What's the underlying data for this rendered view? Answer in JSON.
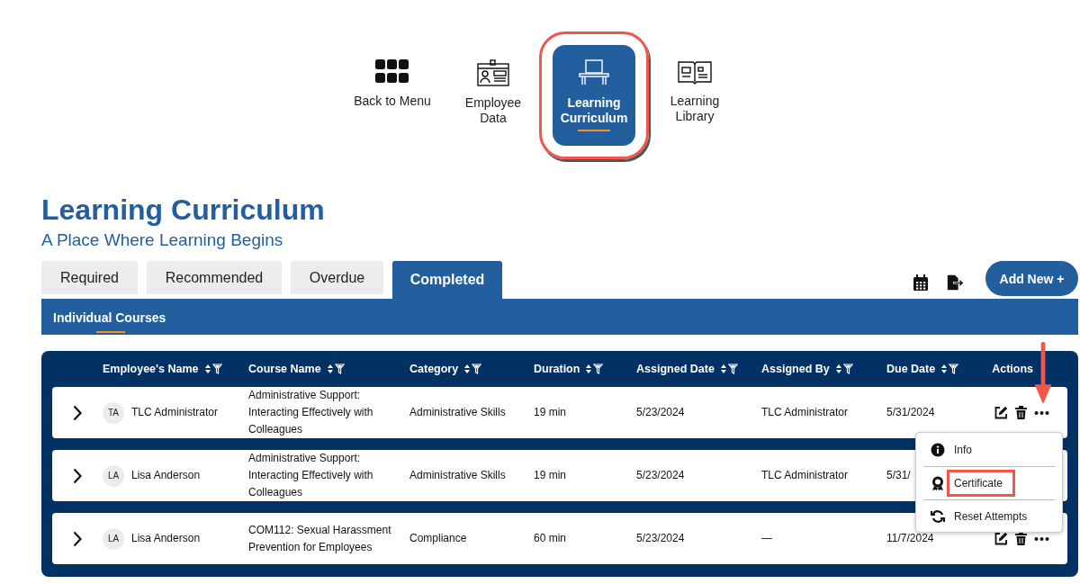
{
  "nav": [
    {
      "label": "Back to Menu",
      "selected": false,
      "highlighted": false
    },
    {
      "label": "Employee Data",
      "selected": false,
      "highlighted": false
    },
    {
      "label": "Learning Curriculum",
      "selected": true,
      "highlighted": true
    },
    {
      "label": "Learning Library",
      "selected": false,
      "highlighted": false
    }
  ],
  "title": "Learning Curriculum",
  "subtitle": "A Place Where Learning Begins",
  "tabs": [
    {
      "label": "Required",
      "selected": false
    },
    {
      "label": "Recommended",
      "selected": false
    },
    {
      "label": "Overdue",
      "selected": false
    },
    {
      "label": "Completed",
      "selected": true
    }
  ],
  "add_button": "Add New +",
  "subtab": "Individual Courses",
  "table": {
    "columns": [
      "Employee's Name",
      "Course Name",
      "Category",
      "Duration",
      "Assigned Date",
      "Assigned By",
      "Due Date"
    ],
    "actions_column": "Actions",
    "rows": [
      {
        "initials": "TA",
        "employee": "TLC Administrator",
        "course": "Administrative Support: Interacting Effectively with Colleagues",
        "category": "Administrative Skills",
        "duration": "19 min",
        "assigned_date": "5/23/2024",
        "assigned_by": "TLC Administrator",
        "due_date": "5/31/2024",
        "menu_open": true
      },
      {
        "initials": "LA",
        "employee": "Lisa Anderson",
        "course": "Administrative Support: Interacting Effectively with Colleagues",
        "category": "Administrative Skills",
        "duration": "19 min",
        "assigned_date": "5/23/2024",
        "assigned_by": "TLC Administrator",
        "due_date": "5/31/",
        "menu_open": false
      },
      {
        "initials": "LA",
        "employee": "Lisa Anderson",
        "course": "COM112: Sexual Harassment Prevention for Employees",
        "category": "Compliance",
        "duration": "60 min",
        "assigned_date": "5/23/2024",
        "assigned_by": "—",
        "due_date": "11/7/2024",
        "menu_open": false
      }
    ]
  },
  "menu": [
    {
      "label": "Info",
      "highlighted": false
    },
    {
      "label": "Certificate",
      "highlighted": true
    },
    {
      "label": "Reset Attempts",
      "highlighted": false
    }
  ]
}
